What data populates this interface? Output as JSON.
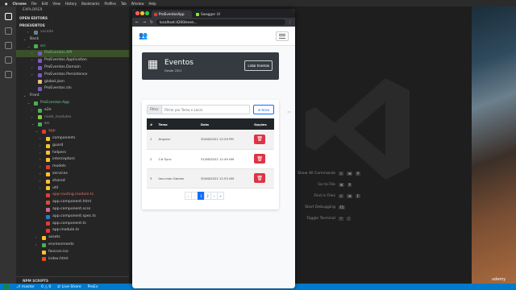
{
  "menubar": {
    "items": [
      "Chrome",
      "File",
      "Edit",
      "View",
      "History",
      "Bookmarks",
      "Profiles",
      "Tab",
      "Window",
      "Help"
    ]
  },
  "vscode": {
    "explorer_title": "EXPLORER",
    "open_editors": "OPEN EDITORS",
    "project": "PROEVENTOS",
    "tree": [
      {
        "label": "vscode",
        "indent": 2,
        "chev": "›",
        "color": "gray",
        "ico": "#6d8086"
      },
      {
        "label": "Back",
        "indent": 1,
        "chev": "⌄",
        "color": "",
        "ico": ""
      },
      {
        "label": "src",
        "indent": 2,
        "chev": "⌄",
        "color": "green",
        "ico": "#4caf50"
      },
      {
        "label": "ProEventos.API",
        "indent": 3,
        "chev": "›",
        "color": "green",
        "ico": "#7e57c2",
        "hl": true
      },
      {
        "label": "ProEventos.Application",
        "indent": 3,
        "chev": "›",
        "color": "",
        "ico": "#7e57c2"
      },
      {
        "label": "ProEventos.Domain",
        "indent": 3,
        "chev": "›",
        "color": "",
        "ico": "#7e57c2"
      },
      {
        "label": "ProEventos.Persistence",
        "indent": 3,
        "chev": "›",
        "color": "",
        "ico": "#7e57c2"
      },
      {
        "label": "global.json",
        "indent": 3,
        "chev": "",
        "color": "",
        "ico": "#e5c07b"
      },
      {
        "label": "ProEventos.sln",
        "indent": 3,
        "chev": "",
        "color": "",
        "ico": "#7e57c2"
      },
      {
        "label": "Front",
        "indent": 1,
        "chev": "⌄",
        "color": "",
        "ico": ""
      },
      {
        "label": "ProEventos-App",
        "indent": 2,
        "chev": "⌄",
        "color": "green",
        "ico": "#4caf50"
      },
      {
        "label": "e2e",
        "indent": 3,
        "chev": "›",
        "color": "",
        "ico": "#4caf50"
      },
      {
        "label": "node_modules",
        "indent": 3,
        "chev": "›",
        "color": "gray",
        "ico": "#8bc34a"
      },
      {
        "label": "src",
        "indent": 3,
        "chev": "⌄",
        "color": "green",
        "ico": "#4caf50"
      },
      {
        "label": "app",
        "indent": 4,
        "chev": "⌄",
        "color": "red",
        "ico": "#e53935"
      },
      {
        "label": "components",
        "indent": 5,
        "chev": "›",
        "color": "",
        "ico": "#fbc02d"
      },
      {
        "label": "guard",
        "indent": 5,
        "chev": "›",
        "color": "",
        "ico": "#fbc02d"
      },
      {
        "label": "helpers",
        "indent": 5,
        "chev": "›",
        "color": "",
        "ico": "#fbc02d"
      },
      {
        "label": "interceptors",
        "indent": 5,
        "chev": "›",
        "color": "",
        "ico": "#fbc02d"
      },
      {
        "label": "models",
        "indent": 5,
        "chev": "›",
        "color": "",
        "ico": "#e53935"
      },
      {
        "label": "services",
        "indent": 5,
        "chev": "›",
        "color": "",
        "ico": "#fbc02d"
      },
      {
        "label": "shared",
        "indent": 5,
        "chev": "›",
        "color": "",
        "ico": "#fbc02d"
      },
      {
        "label": "util",
        "indent": 5,
        "chev": "›",
        "color": "",
        "ico": "#fbc02d"
      },
      {
        "label": "app-routing.module.ts",
        "indent": 5,
        "chev": "",
        "color": "red",
        "ico": "#e53935"
      },
      {
        "label": "app.component.html",
        "indent": 5,
        "chev": "",
        "color": "",
        "ico": "#e44d26"
      },
      {
        "label": "app.component.scss",
        "indent": 5,
        "chev": "",
        "color": "",
        "ico": "#cd6799"
      },
      {
        "label": "app.component.spec.ts",
        "indent": 5,
        "chev": "",
        "color": "",
        "ico": "#3178c6"
      },
      {
        "label": "app.component.ts",
        "indent": 5,
        "chev": "",
        "color": "",
        "ico": "#e53935"
      },
      {
        "label": "app.module.ts",
        "indent": 5,
        "chev": "",
        "color": "",
        "ico": "#e53935"
      },
      {
        "label": "assets",
        "indent": 4,
        "chev": "›",
        "color": "",
        "ico": "#fbc02d"
      },
      {
        "label": "environments",
        "indent": 4,
        "chev": "›",
        "color": "",
        "ico": "#4caf50"
      },
      {
        "label": "favicon.ico",
        "indent": 4,
        "chev": "",
        "color": "",
        "ico": "#fbc02d"
      },
      {
        "label": "index.html",
        "indent": 4,
        "chev": "",
        "color": "",
        "ico": "#e44d26"
      }
    ],
    "npm_scripts": "NPM SCRIPTS",
    "shortcuts": [
      {
        "label": "Show All Commands",
        "keys": [
          "⇧",
          "⌘",
          "P"
        ]
      },
      {
        "label": "Go to File",
        "keys": [
          "⌘",
          "P"
        ]
      },
      {
        "label": "Find in Files",
        "keys": [
          "⇧",
          "⌘",
          "F"
        ]
      },
      {
        "label": "Start Debugging",
        "keys": [
          "F5"
        ]
      },
      {
        "label": "Toggle Terminal",
        "keys": [
          "⌃",
          "`"
        ]
      }
    ],
    "status": {
      "branch": "master",
      "sync": "0 △ 0",
      "live_share": "Live Share",
      "proj": "ProEv"
    }
  },
  "chrome": {
    "tabs": [
      {
        "title": "ProEventosApp",
        "fav": "#e53935",
        "active": true
      },
      {
        "title": "Swagger UI",
        "fav": "#85ea2d",
        "active": false
      }
    ],
    "url": "localhost:4200/even..."
  },
  "app": {
    "header": {
      "title": "Eventos",
      "subtitle": "Desde 2021",
      "listar": "Listar Eventos"
    },
    "filter": {
      "label": "Filtro:",
      "placeholder": "Filtrar por Tema e Local",
      "novo": "Novo"
    },
    "table": {
      "headers": [
        "#",
        "Tema",
        "Data",
        "Opções"
      ],
      "rows": [
        [
          "1",
          "Angular",
          "30/06/2022 12:29 PM"
        ],
        [
          "2",
          "C# Sync",
          "31/08/2022 11:49 AM"
        ],
        [
          "3",
          "Iron-man Games",
          "30/06/2022 11:53 AM"
        ]
      ]
    },
    "pager": [
      "«",
      "‹",
      "1",
      "2",
      "›",
      "»"
    ],
    "pager_active": "1"
  },
  "watermark": "udemy"
}
